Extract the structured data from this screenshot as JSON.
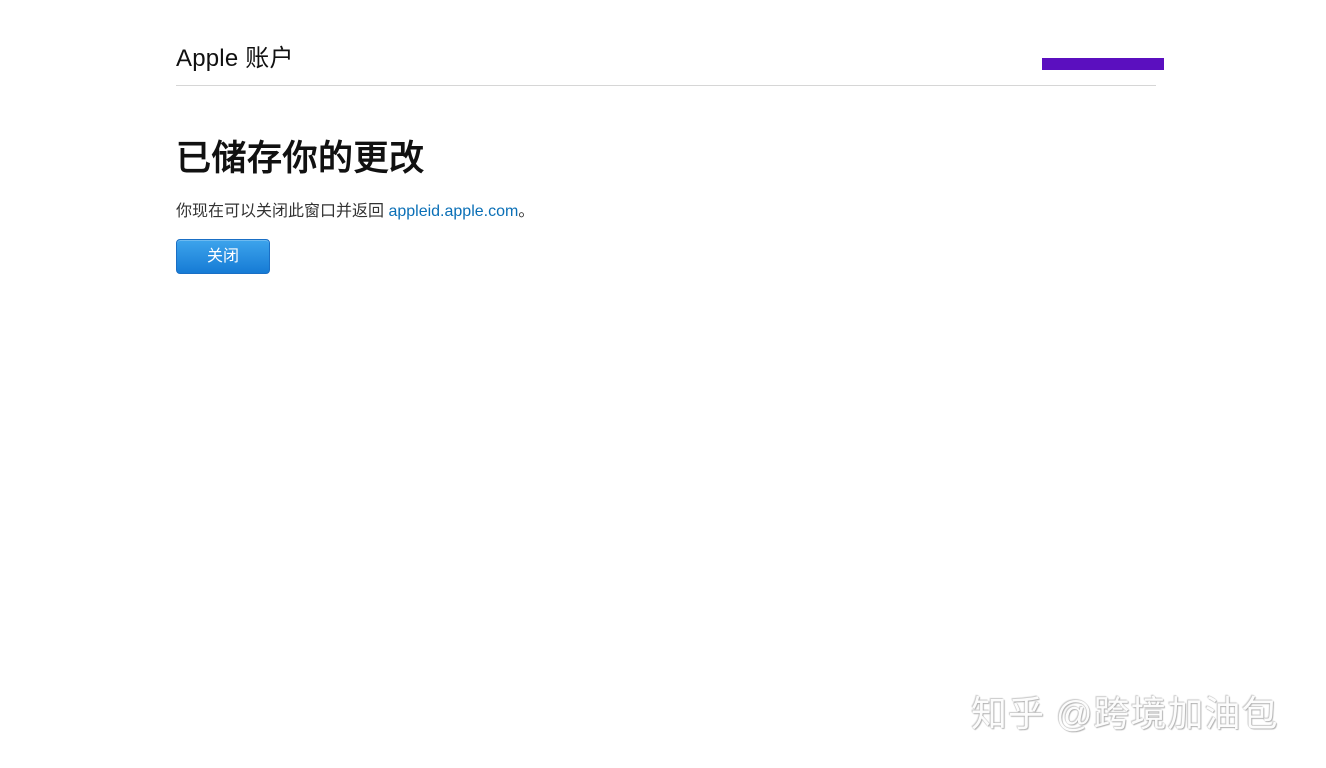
{
  "header": {
    "brand": "Apple 账户"
  },
  "main": {
    "title": "已储存你的更改",
    "description_prefix": "你现在可以关闭此窗口并返回 ",
    "link_text": "appleid.apple.com",
    "description_suffix": "。",
    "close_button_label": "关闭"
  },
  "watermark": {
    "text": "知乎 @跨境加油包"
  },
  "colors": {
    "link": "#0a6fb6",
    "button": "#167bd5",
    "redaction": "#5b0fbf"
  }
}
